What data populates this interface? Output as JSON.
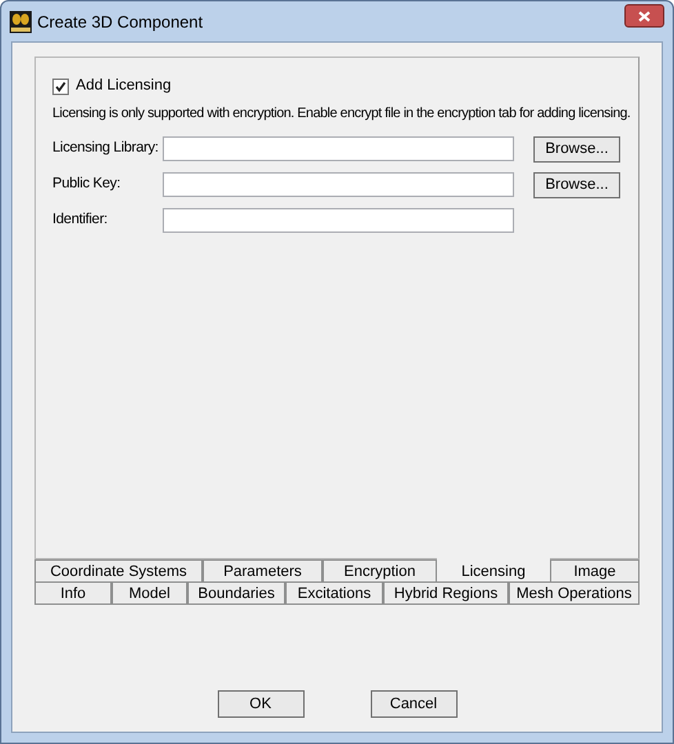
{
  "window": {
    "title": "Create 3D Component"
  },
  "add_licensing": {
    "label": "Add Licensing",
    "checked": true
  },
  "note": "Licensing is only supported with encryption. Enable encrypt file in the encryption tab for adding licensing.",
  "fields": [
    {
      "label": "Licensing Library:",
      "button": "Browse..."
    },
    {
      "label": "Public Key:",
      "button": "Browse..."
    },
    {
      "label": "Identifier:"
    }
  ],
  "tab_rows": [
    [
      {
        "label": "Coordinate Systems",
        "selected": false
      },
      {
        "label": "Parameters",
        "selected": false
      },
      {
        "label": "Encryption",
        "selected": false
      },
      {
        "label": "Licensing",
        "selected": true
      },
      {
        "label": "Image",
        "selected": false
      }
    ],
    [
      {
        "label": "Info",
        "selected": false
      },
      {
        "label": "Model",
        "selected": false
      },
      {
        "label": "Boundaries",
        "selected": false
      },
      {
        "label": "Excitations",
        "selected": false
      },
      {
        "label": "Hybrid Regions",
        "selected": false
      },
      {
        "label": "Mesh Operations",
        "selected": false
      }
    ]
  ],
  "buttons": [
    "OK",
    "Cancel"
  ]
}
